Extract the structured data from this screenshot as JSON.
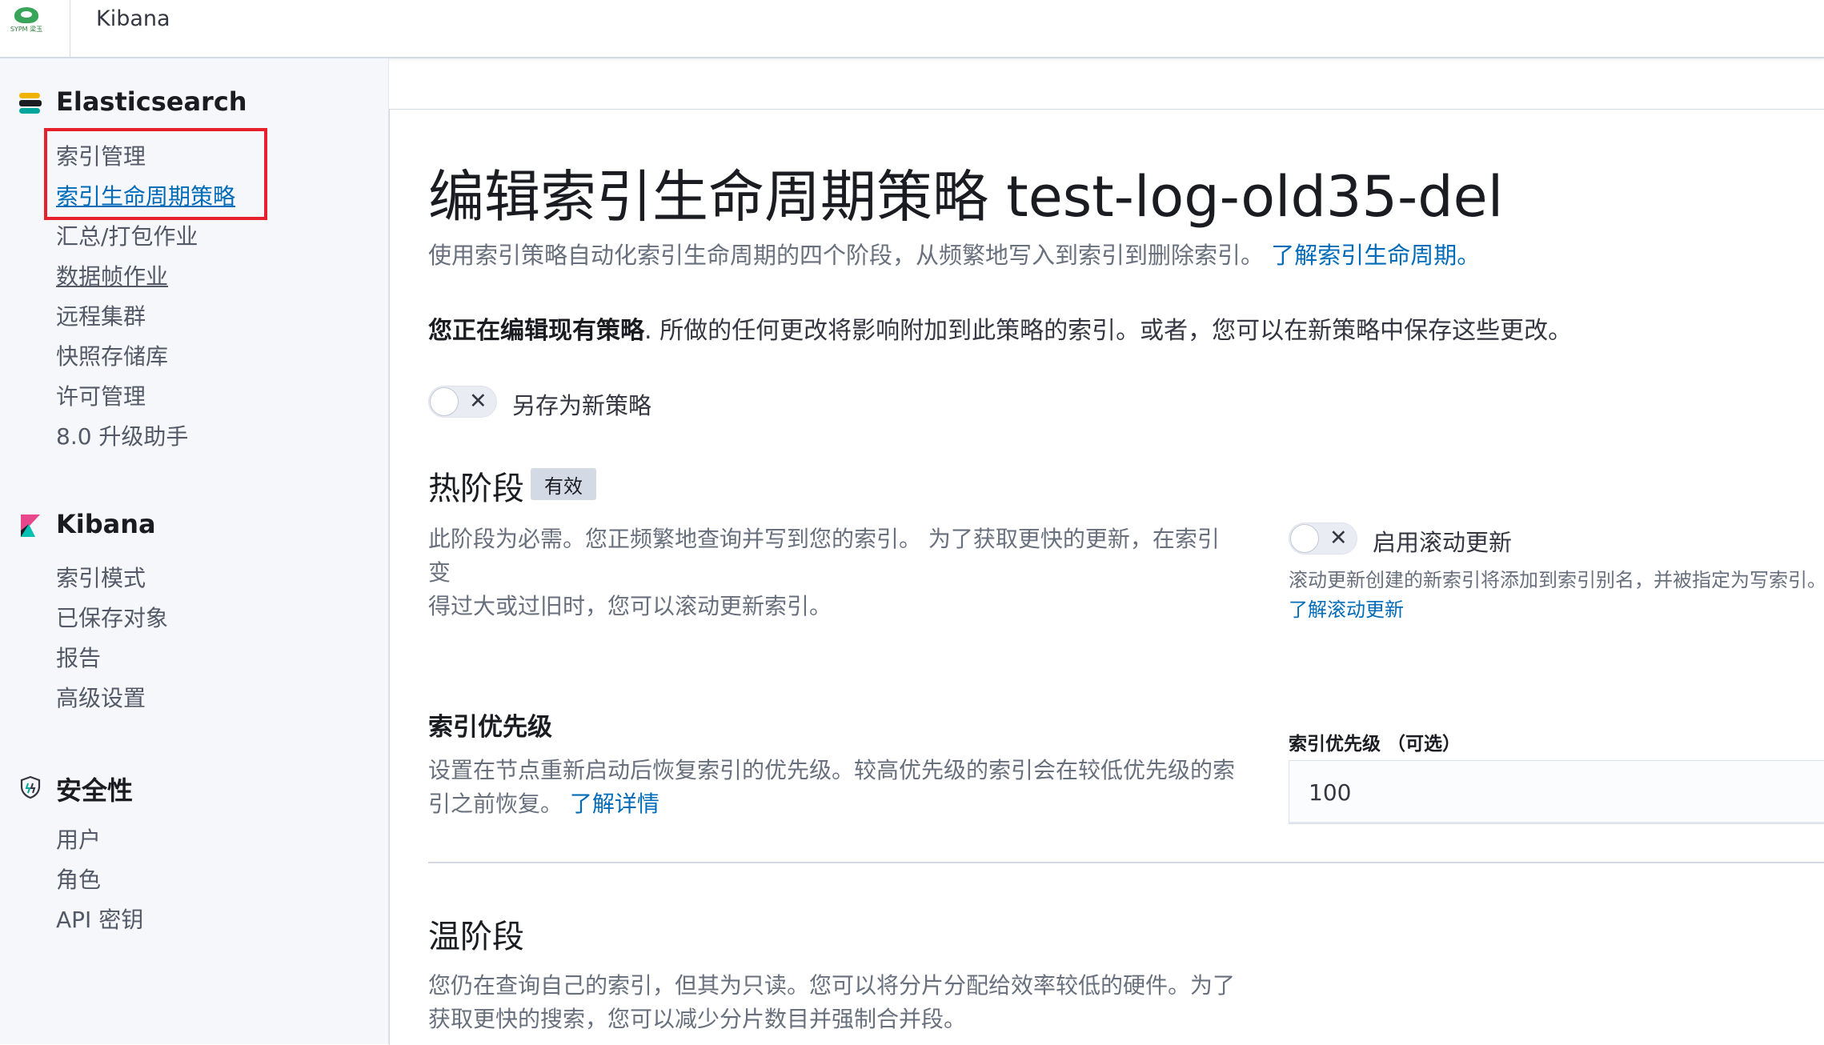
{
  "header": {
    "logo_text": "SYPM 梁玉",
    "app_name": "Kibana"
  },
  "sidebar": {
    "sections": [
      {
        "title": "Elasticsearch",
        "icon": "elasticsearch-icon",
        "items": [
          {
            "label": "索引管理"
          },
          {
            "label": "索引生命周期策略",
            "active": true
          },
          {
            "label": "汇总/打包作业"
          },
          {
            "label": "数据帧作业"
          },
          {
            "label": "远程集群"
          },
          {
            "label": "快照存储库"
          },
          {
            "label": "许可管理"
          },
          {
            "label": "8.0 升级助手"
          }
        ]
      },
      {
        "title": "Kibana",
        "icon": "kibana-icon",
        "items": [
          {
            "label": "索引模式"
          },
          {
            "label": "已保存对象"
          },
          {
            "label": "报告"
          },
          {
            "label": "高级设置"
          }
        ]
      },
      {
        "title": "安全性",
        "icon": "shield-icon",
        "items": [
          {
            "label": "用户"
          },
          {
            "label": "角色"
          },
          {
            "label": "API 密钥"
          }
        ]
      }
    ]
  },
  "main": {
    "title": "编辑索引生命周期策略 test-log-old35-del",
    "description": "使用索引策略自动化索引生命周期的四个阶段，从频繁地写入到索引到删除索引。",
    "description_link": "了解索引生命周期。",
    "editing_bold": "您正在编辑现有策略",
    "editing_rest": ". 所做的任何更改将影响附加到此策略的索引。或者，您可以在新策略中保存这些更改。",
    "save_as_new_label": "另存为新策略",
    "hot_phase": {
      "title": "热阶段",
      "badge": "有效",
      "description_line1": "此阶段为必需。您正频繁地查询并写到您的索引。 为了获取更快的更新，在索引变",
      "description_line2": "得过大或过旧时，您可以滚动更新索引。",
      "rollover_label": "启用滚动更新",
      "rollover_help": "滚动更新创建的新索引将添加到索引别名，并被指定为写索引。",
      "rollover_link": "了解滚动更新"
    },
    "index_priority": {
      "title": "索引优先级",
      "description_line1": "设置在节点重新启动后恢复索引的优先级。较高优先级的索引会在较低优先级的索",
      "description_line2": "引之前恢复。",
      "link": "了解详情",
      "field_label": "索引优先级 （可选）",
      "field_value": "100"
    },
    "warm_phase": {
      "title": "温阶段",
      "description_line1": "您仍在查询自己的索引，但其为只读。您可以将分片分配给效率较低的硬件。为了",
      "description_line2": "获取更快的搜索，您可以减少分片数目并强制合并段。"
    }
  },
  "colors": {
    "link": "#006bb8",
    "highlight_box": "#e7212b",
    "sidebar_bg": "#f5f7fa"
  }
}
